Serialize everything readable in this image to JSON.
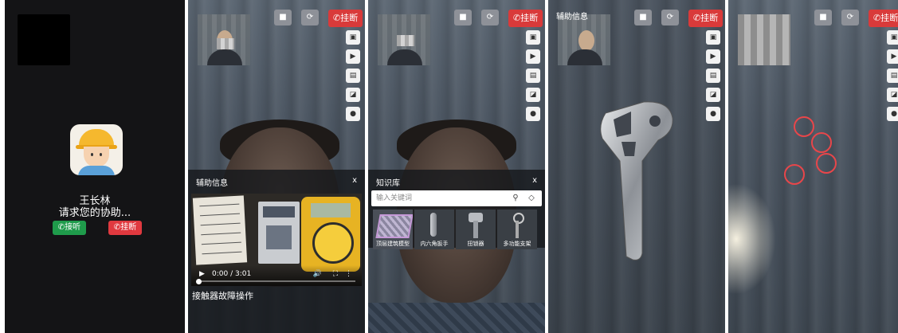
{
  "colors": {
    "accept": "#1f9b4b",
    "decline": "#e0393f",
    "hangup": "#d93a3a",
    "marker": "#e8464a"
  },
  "incoming": {
    "caller_name": "王长林",
    "message": "请求您的协助...",
    "accept_label": "接听",
    "decline_label": "挂断"
  },
  "call_toolbar": {
    "hangup_label": "挂断",
    "icons": [
      "camera-icon",
      "switch-camera-icon"
    ]
  },
  "side_tools": [
    "image-icon",
    "video-icon",
    "keyboard-icon",
    "note-icon",
    "record-icon"
  ],
  "assist_panel": {
    "title": "辅助信息",
    "close": "x",
    "video_time": "0:00 / 3:01",
    "video_title": "接触器故障操作",
    "play_state": "paused",
    "progress_fraction": 0.0
  },
  "knowledge_panel": {
    "title": "知识库",
    "close": "x",
    "search_placeholder": "输入关键词",
    "items": [
      "顶层建筑模型",
      "内六角扳手",
      "扭锁器",
      "多功能支架"
    ]
  },
  "model_panel": {
    "title": "辅助信息"
  }
}
